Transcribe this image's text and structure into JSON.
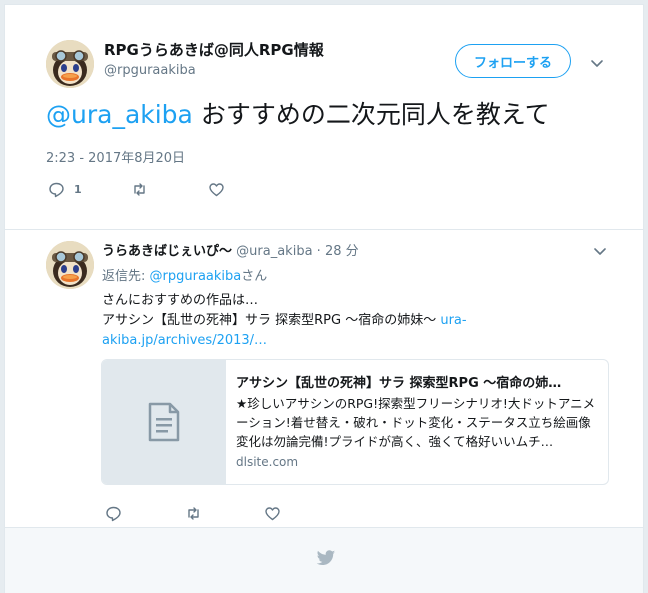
{
  "main_tweet": {
    "author_name": "RPGうらあきば@同人RPG情報",
    "author_handle": "@rpguraakiba",
    "follow_label": "フォローする",
    "mention": "@ura_akiba",
    "text": " おすすめの二次元同人を教えて",
    "timestamp": "2:23 - 2017年8月20日",
    "reply_count": "1"
  },
  "reply": {
    "name": "うらあきばじぇいぴ〜",
    "handle": "@ura_akiba",
    "separator": " · ",
    "time": "28 分",
    "reply_to_prefix": "返信先: ",
    "reply_to_handle": "@rpguraakiba",
    "reply_to_suffix": "さん",
    "body_line1": "さんにおすすめの作品は…",
    "body_line2": "アサシン【乱世の死神】サラ 探索型RPG 〜宿命の姉妹〜 ",
    "body_link": "ura-akiba.jp/archives/2013/…",
    "card": {
      "title": "アサシン【乱世の死神】サラ 探索型RPG 〜宿命の姉…",
      "description": "★珍しいアサシンのRPG!探索型フリーシナリオ!大ドットアニメーション!着せ替え・破れ・ドット変化・ステータス立ち絵画像変化は勿論完備!プライドが高く、強くて格好いいムチ…",
      "domain": "dlsite.com"
    }
  },
  "icons": {
    "reply": "reply-icon",
    "retweet": "retweet-icon",
    "like": "heart-icon",
    "chevron": "chevron-down-icon",
    "card_placeholder": "document-icon",
    "footer": "twitter-bird-icon"
  },
  "colors": {
    "accent": "#1da1f2",
    "secondary_text": "#657786",
    "border": "#e1e8ed",
    "footer_bg": "#f5f8fa",
    "page_bg": "#e6ecf0"
  }
}
